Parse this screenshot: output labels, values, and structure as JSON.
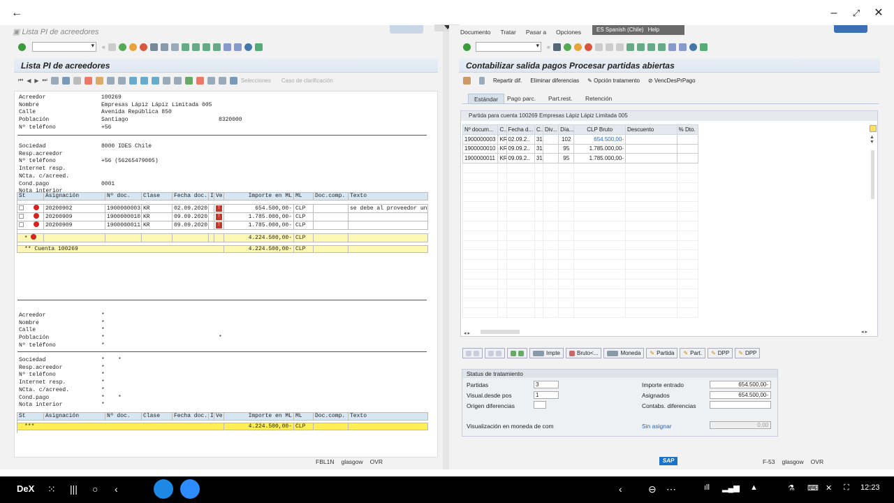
{
  "left": {
    "window_title": "Lista PI de acreedores",
    "header": "Lista PI de acreedores",
    "toolbar": {
      "selecciones": "Selecciones",
      "caso": "Caso de clarificación"
    },
    "vendor": [
      {
        "k": "Acreedor",
        "v": "100269"
      },
      {
        "k": "Nombre",
        "v": "Empresas Lápiz Lápiz Limitada 005"
      },
      {
        "k": "Calle",
        "v": "Avenida República 850"
      },
      {
        "k": "Población",
        "v": "Santiago",
        "v2": "8320000"
      },
      {
        "k": "Nº teléfono",
        "v": "+56"
      }
    ],
    "company": [
      {
        "k": "Sociedad",
        "v": "8000 IDES Chile"
      },
      {
        "k": "Resp.acreedor",
        "v": ""
      },
      {
        "k": "Nº teléfono",
        "v": "+56 (56265479005)"
      },
      {
        "k": "Internet resp.",
        "v": ""
      },
      {
        "k": "NCta. c/acreed.",
        "v": ""
      },
      {
        "k": "Cond.pago",
        "v": "0001"
      },
      {
        "k": "Nota interior",
        "v": ""
      }
    ],
    "columns": [
      "St",
      "Asignación",
      "Nº doc.",
      "Clase",
      "Fecha doc.",
      "I",
      "Ve",
      "Importe en ML",
      "ML",
      "Doc.comp.",
      "Texto"
    ],
    "rows": [
      {
        "asig": "20200902",
        "doc": "1900000003",
        "clase": "KR",
        "fecha": "02.09.2020",
        "imp": "654.500,00-",
        "ml": "CLP",
        "texto": "se debe al proveedor un"
      },
      {
        "asig": "20200909",
        "doc": "1900000010",
        "clase": "KR",
        "fecha": "09.09.2020",
        "imp": "1.785.000,00-",
        "ml": "CLP",
        "texto": ""
      },
      {
        "asig": "20200909",
        "doc": "1900000011",
        "clase": "KR",
        "fecha": "09.09.2020",
        "imp": "1.785.000,00-",
        "ml": "CLP",
        "texto": ""
      }
    ],
    "subtotal": {
      "mark": "*",
      "imp": "4.224.500,00-",
      "ml": "CLP"
    },
    "cuenta": {
      "label": "** Cuenta 100269",
      "imp": "4.224.500,00-",
      "ml": "CLP"
    },
    "vendor2": [
      {
        "k": "Acreedor",
        "v": "*"
      },
      {
        "k": "Nombre",
        "v": "*"
      },
      {
        "k": "Calle",
        "v": "*"
      },
      {
        "k": "Población",
        "v": "*",
        "v2": "*"
      },
      {
        "k": "Nº teléfono",
        "v": "*"
      }
    ],
    "company2": [
      {
        "k": "Sociedad",
        "v": "*",
        "v2": "*"
      },
      {
        "k": "Resp.acreedor",
        "v": "*"
      },
      {
        "k": "Nº teléfono",
        "v": "*"
      },
      {
        "k": "Internet resp.",
        "v": "*"
      },
      {
        "k": "NCta. c/acreed.",
        "v": "*"
      },
      {
        "k": "Cond.pago",
        "v": "*",
        "v2": "*"
      },
      {
        "k": "Nota interior",
        "v": "*"
      }
    ],
    "total": {
      "label": "***",
      "imp": "4.224.500,00-",
      "ml": "CLP"
    },
    "status": {
      "tcode": "FBL1N",
      "server": "glasgow",
      "mode": "OVR"
    }
  },
  "right": {
    "menu": [
      "Documento",
      "Tratar",
      "Pasar a",
      "Opciones"
    ],
    "lang": "ES Spanish (Chile)",
    "help": "Help",
    "header": "Contabilizar salida pagos Procesar partidas abiertas",
    "actions": [
      "Repartir dif.",
      "Eliminar diferencias",
      "Opción tratamento",
      "VencDesPrPago"
    ],
    "tabs": [
      "Estándar",
      "Pago parc.",
      "Part.rest.",
      "Retención"
    ],
    "grid_title": "Partida para cuenta 100269 Empresas Lápiz Lápiz Limitada 005",
    "columns": [
      "Nº docum...",
      "C..",
      "Fecha d...",
      "C..",
      "Div...",
      "Día...",
      "CLP Bruto",
      "Descuento",
      "% Dto."
    ],
    "rows": [
      {
        "doc": "1900000003",
        "c": "KR",
        "fecha": "02.09.2..",
        "c2": "31",
        "div": "",
        "dia": "102",
        "bruto": "654.500,00-"
      },
      {
        "doc": "1900000010",
        "c": "KR",
        "fecha": "09.09.2..",
        "c2": "31",
        "div": "",
        "dia": "95",
        "bruto": "1.785.000,00-"
      },
      {
        "doc": "1900000011",
        "c": "KR",
        "fecha": "09.09.2..",
        "c2": "31",
        "div": "",
        "dia": "95",
        "bruto": "1.785.000,00-"
      }
    ],
    "buttons": [
      "Impte",
      "Bruto<...",
      "Moneda",
      "Partida",
      "Part.",
      "DPP",
      "DPP"
    ],
    "status_box": {
      "title": "Status de tratamiento",
      "partidas_label": "Partidas",
      "partidas": "3",
      "visual_label": "Visual.desde pos",
      "visual": "1",
      "origen_label": "Origen diferencias",
      "vis_moneda": "Visualización en moneda de com",
      "imp_entrado_label": "Importe entrado",
      "imp_entrado": "654.500,00-",
      "asignados_label": "Asignados",
      "asignados": "654.500,00-",
      "contabs_label": "Contabs. diferencias",
      "sin_asignar_label": "Sin asignar",
      "sin_asignar": "0,00"
    },
    "status": {
      "tcode": "F-53",
      "server": "glasgow",
      "mode": "OVR"
    }
  },
  "navbar": {
    "dex": "DeX",
    "time": "12:23"
  },
  "colors": {
    "accent": "#0a6ed1",
    "yellow": "#ffee55",
    "red": "#d6241e"
  }
}
